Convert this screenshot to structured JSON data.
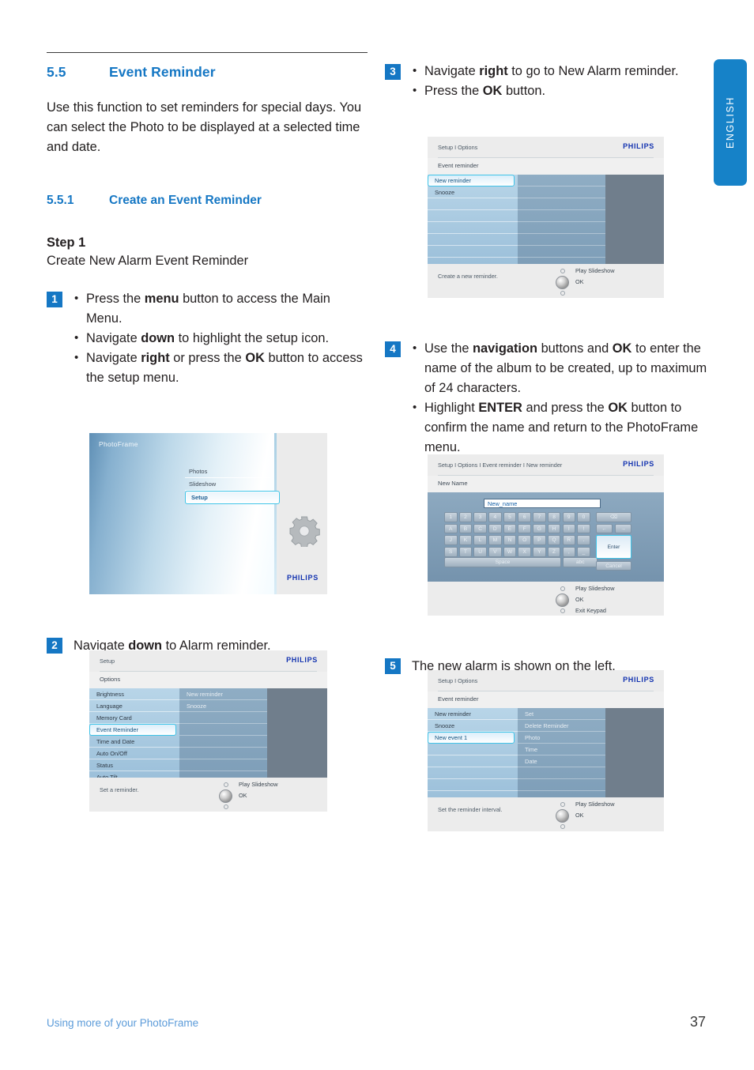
{
  "language_tab": "ENGLISH",
  "section": {
    "number": "5.5",
    "title": "Event Reminder",
    "intro": "Use this function to set reminders for special days. You can select the Photo to be displayed at a selected time and date."
  },
  "subsection": {
    "number": "5.5.1",
    "title": "Create an Event Reminder",
    "step_heading": "Step 1",
    "step_subheading": "Create New Alarm Event Reminder"
  },
  "steps": {
    "one": {
      "num": "1",
      "bullets_html": [
        "Press the <b>menu</b> button to access the Main Menu.",
        "Navigate <b>down</b> to highlight the setup icon.",
        "Navigate <b>right</b> or press the <b>OK</b> button to access the setup menu."
      ]
    },
    "two": {
      "num": "2",
      "text_html": "Navigate <b>down</b> to Alarm reminder."
    },
    "three": {
      "num": "3",
      "bullets_html": [
        "Navigate <b>right</b> to go to New Alarm reminder.",
        "Press the <b>OK</b> button."
      ]
    },
    "four": {
      "num": "4",
      "bullets_html": [
        "Use the <b>navigation</b> buttons and <b>OK</b> to enter the name of the album to be created, up to maximum of 24 characters.",
        "Highlight <b>ENTER</b> and press the <b>OK</b> button to confirm the name and return to the PhotoFrame menu."
      ]
    },
    "five": {
      "num": "5",
      "text_html": "The new alarm is shown on the left."
    }
  },
  "shot_menu": {
    "title": "PhotoFrame",
    "items": [
      "Photos",
      "Slideshow",
      "Setup"
    ],
    "selected": "Setup",
    "brand": "PHILIPS",
    "gear_icon": "gear-icon"
  },
  "shot_setup": {
    "crumb": "Setup",
    "brand": "PHILIPS",
    "subtitle": "Options",
    "col_a": [
      "Brightness",
      "Language",
      "Memory Card",
      "Event Reminder",
      "Time and Date",
      "Auto On/Off",
      "Status",
      "Auto Tilt"
    ],
    "col_a_selected": "Event Reminder",
    "col_b": [
      "New reminder",
      "Snooze"
    ],
    "hint": "Set a reminder.",
    "nav": [
      "Play Slideshow",
      "OK",
      ""
    ]
  },
  "shot_event": {
    "crumb": "Setup I Options",
    "brand": "PHILIPS",
    "subtitle": "Event reminder",
    "col_a": [
      "New reminder",
      "Snooze"
    ],
    "col_a_selected": "New reminder",
    "col_b": [],
    "hint": "Create a new reminder.",
    "nav": [
      "Play Slideshow",
      "OK",
      ""
    ]
  },
  "shot_keyboard": {
    "crumb": "Setup I Options I Event reminder I New reminder",
    "brand": "PHILIPS",
    "subtitle": "New Name",
    "input_value": "New_name",
    "rows": [
      [
        "1",
        "2",
        "3",
        "4",
        "5",
        "6",
        "7",
        "8",
        "9",
        "0"
      ],
      [
        "A",
        "B",
        "C",
        "D",
        "E",
        "F",
        "G",
        "H",
        "I",
        "!"
      ],
      [
        "J",
        "K",
        "L",
        "M",
        "N",
        "O",
        "P",
        "Q",
        "R",
        "."
      ],
      [
        "S",
        "T",
        "U",
        "V",
        "W",
        "X",
        "Y",
        "Z",
        ",",
        "_"
      ]
    ],
    "space_label": "Space",
    "abc_label": "abc",
    "backspace_label": "⌫",
    "arrow_left": "←",
    "arrow_right": "→",
    "enter_label": "Enter",
    "cancel_label": "Cancel",
    "nav": [
      "Play Slideshow",
      "OK",
      "Exit Keypad"
    ]
  },
  "shot_newevent": {
    "crumb": "Setup I Options",
    "brand": "PHILIPS",
    "subtitle": "Event reminder",
    "col_a": [
      "New reminder",
      "Snooze",
      "New event 1"
    ],
    "col_a_selected": "New event 1",
    "col_b": [
      "Set",
      "Delete Reminder",
      "Photo",
      "Time",
      "Date"
    ],
    "hint": "Set the reminder interval.",
    "nav": [
      "Play Slideshow",
      "OK",
      ""
    ]
  },
  "footer": {
    "left": "Using more of your PhotoFrame",
    "page": "37"
  },
  "colors": {
    "accent": "#1577c4",
    "tab": "#1682c8",
    "footer_link": "#5b9bd9",
    "philips": "#1333b0",
    "highlight": "#3fc4e8"
  }
}
